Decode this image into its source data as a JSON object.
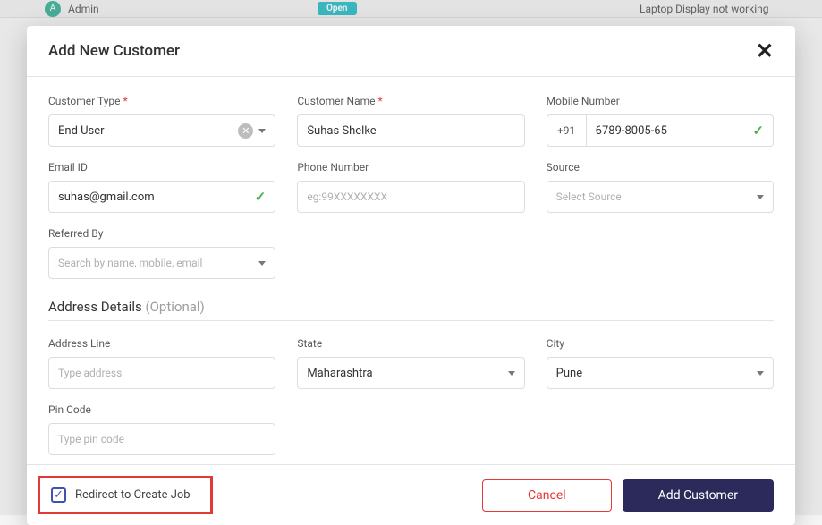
{
  "background": {
    "admin_avatar_letter": "A",
    "admin_label": "Admin",
    "status": "Open",
    "ticket_title": "Laptop Display not working"
  },
  "modal": {
    "title": "Add New Customer",
    "fields": {
      "customer_type": {
        "label": "Customer Type",
        "value": "End User"
      },
      "customer_name": {
        "label": "Customer Name",
        "value": "Suhas Shelke"
      },
      "mobile": {
        "label": "Mobile Number",
        "cc": "+91",
        "value": "6789-8005-65"
      },
      "email": {
        "label": "Email ID",
        "value": "suhas@gmail.com"
      },
      "phone": {
        "label": "Phone Number",
        "placeholder": "eg:99XXXXXXXX"
      },
      "source": {
        "label": "Source",
        "placeholder": "Select Source"
      },
      "referred": {
        "label": "Referred By",
        "placeholder": "Search by name, mobile, email"
      },
      "address_section": {
        "title": "Address Details",
        "optional": "(Optional)"
      },
      "address_line": {
        "label": "Address Line",
        "placeholder": "Type address"
      },
      "state": {
        "label": "State",
        "value": "Maharashtra"
      },
      "city": {
        "label": "City",
        "value": "Pune"
      },
      "pin": {
        "label": "Pin Code",
        "placeholder": "Type pin code"
      }
    },
    "footer": {
      "redirect_label": "Redirect to Create Job",
      "cancel": "Cancel",
      "submit": "Add Customer"
    }
  }
}
